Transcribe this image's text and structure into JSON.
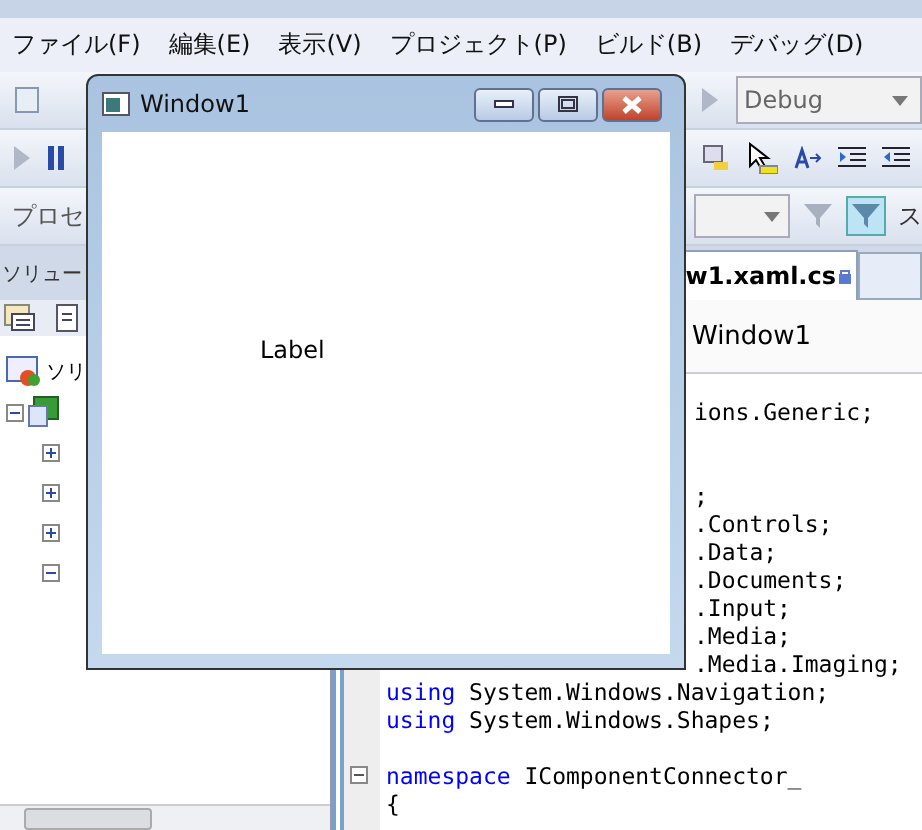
{
  "ide": {
    "menu": [
      "ファイル(F)",
      "編集(E)",
      "表示(V)",
      "プロジェクト(P)",
      "ビルド(B)",
      "デバッグ(D)"
    ],
    "config_combo": "Debug",
    "process_label": "プロセ",
    "filter_label": "ス",
    "solution_panel_title": "ソリュー",
    "tab": {
      "label": "w1.xaml.cs",
      "locked": true,
      "selected": true
    },
    "member_nav": "Window1",
    "solution_tree": {
      "label": "ソリ",
      "children": [
        {
          "expanded": true,
          "children": [
            {
              "expanded": false
            },
            {
              "expanded": false
            },
            {
              "expanded": false
            },
            {
              "expanded": true
            }
          ]
        }
      ]
    },
    "code_lines": [
      {
        "kind": "partial",
        "text": "ions.Generic;"
      },
      {
        "kind": "hidden"
      },
      {
        "kind": "hidden"
      },
      {
        "kind": "partial",
        "text": ";"
      },
      {
        "kind": "partial",
        "text": ".Controls;"
      },
      {
        "kind": "partial",
        "text": ".Data;"
      },
      {
        "kind": "partial",
        "text": ".Documents;"
      },
      {
        "kind": "partial",
        "text": ".Input;"
      },
      {
        "kind": "partial",
        "text": ".Media;"
      },
      {
        "kind": "partial",
        "text": ".Media.Imaging;"
      },
      {
        "kind": "code",
        "tokens": [
          {
            "kind": "keyword",
            "text": "using"
          },
          {
            "kind": "plain",
            "text": " System.Windows.Navigation;"
          }
        ]
      },
      {
        "kind": "code",
        "tokens": [
          {
            "kind": "keyword",
            "text": "using"
          },
          {
            "kind": "plain",
            "text": " System.Windows.Shapes;"
          }
        ]
      },
      {
        "kind": "blank"
      },
      {
        "kind": "code",
        "fold": true,
        "tokens": [
          {
            "kind": "keyword",
            "text": "namespace"
          },
          {
            "kind": "plain",
            "text": " IComponentConnector_"
          }
        ]
      },
      {
        "kind": "code",
        "tokens": [
          {
            "kind": "plain",
            "text": "{"
          }
        ]
      }
    ]
  },
  "window": {
    "title": "Window1",
    "label": "Label"
  }
}
